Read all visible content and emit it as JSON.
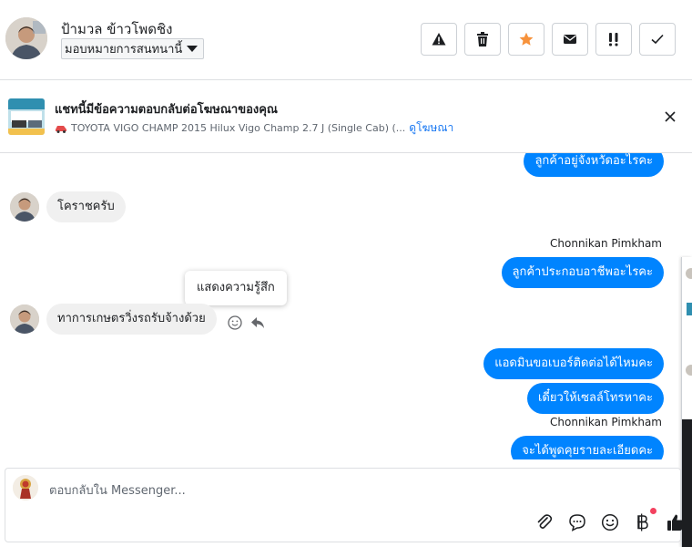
{
  "header": {
    "contact_name": "ป้ามวล ข้าวโพดชิง",
    "assign_label": "มอบหมายการสนทนานี้",
    "actions": [
      {
        "name": "spam-button",
        "icon": "warning-icon"
      },
      {
        "name": "delete-button",
        "icon": "trash-icon"
      },
      {
        "name": "star-button",
        "icon": "star-icon"
      },
      {
        "name": "unread-button",
        "icon": "envelope-icon"
      },
      {
        "name": "follow-up-button",
        "icon": "exclamation-icon"
      },
      {
        "name": "done-button",
        "icon": "check-icon"
      }
    ],
    "star_color": "#f7923b"
  },
  "ad": {
    "title": "แชทนี้มีข้อความตอบกลับต่อโฆษณาของคุณ",
    "subtitle": "TOYOTA VIGO CHAMP 2015 Hilux Vigo Champ 2.7 J (Single Cab) (...",
    "link": "ดูโฆษณา"
  },
  "thread": {
    "messages": [
      {
        "dir": "out",
        "text": "ลูกค้าอยู่จังหวัดอะไรคะ"
      },
      {
        "dir": "in",
        "text": "โคราชครับ"
      },
      {
        "dir": "out",
        "sender": "Chonnikan Pimkham",
        "text": "ลูกค้าประกอบอาชีพอะไรคะ"
      },
      {
        "dir": "in",
        "text": "ทาการเกษตรวิ่งรถรับจ้างด้วย"
      },
      {
        "dir": "out",
        "text": "แอดมินขอเบอร์ติดต่อได้ไหมคะ"
      },
      {
        "dir": "out",
        "text": "เดี๋ยวให้เซลล์โทรหาคะ"
      },
      {
        "dir": "out",
        "sender": "Chonnikan Pimkham",
        "text": "จะได้พูดคุยรายละเอียดคะ"
      }
    ],
    "tooltip": "แสดงความรู้สึก"
  },
  "composer": {
    "placeholder": "ตอบกลับใน Messenger...",
    "tools": [
      "paperclip-icon",
      "saved-reply-icon",
      "emoji-icon",
      "baht-icon",
      "thumbs-up-icon"
    ]
  },
  "colors": {
    "brand_blue": "#0084ff",
    "link_blue": "#1877f2",
    "incoming_bubble": "#f0f0f0"
  }
}
